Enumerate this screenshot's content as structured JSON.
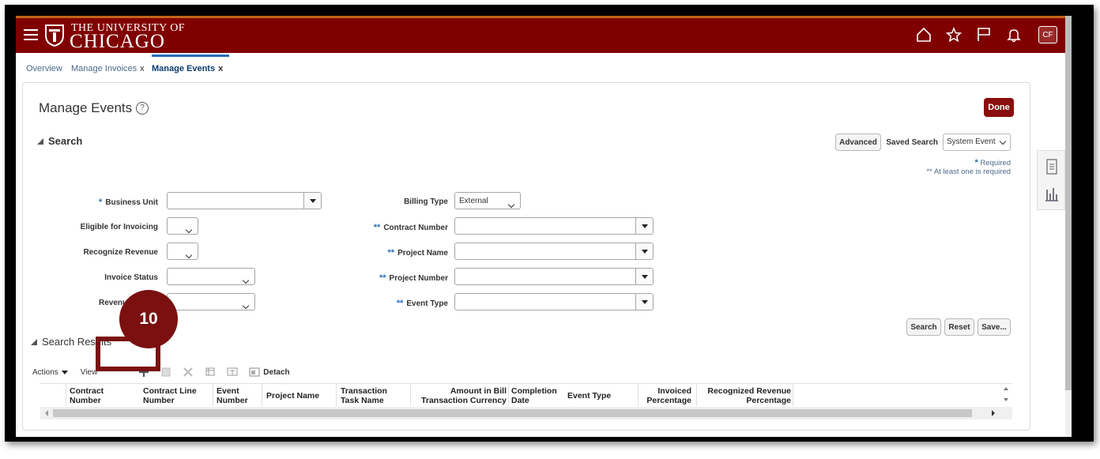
{
  "brand": {
    "line1": "THE UNIVERSITY OF",
    "line2": "CHICAGO"
  },
  "topbar": {
    "icons": [
      "home-icon",
      "star-icon",
      "flag-icon",
      "bell-icon"
    ],
    "user_initials": "CF",
    "color": "#800000"
  },
  "tabs": [
    {
      "label": "Overview",
      "closable": false,
      "active": false
    },
    {
      "label": "Manage Invoices",
      "closable": true,
      "active": false
    },
    {
      "label": "Manage Events",
      "closable": true,
      "active": true
    }
  ],
  "tab_close_glyph": "x",
  "page": {
    "title": "Manage Events",
    "help_glyph": "?",
    "done_label": "Done"
  },
  "search": {
    "header": "Search",
    "advanced_label": "Advanced",
    "saved_search_label": "Saved Search",
    "saved_search_value": "System Event",
    "required_note": "Required",
    "required_marker": "*",
    "atleast_note": "** At least one is required",
    "left_fields": [
      {
        "label": "Business Unit",
        "marker": "*",
        "value": ""
      },
      {
        "label": "Eligible for Invoicing",
        "marker": "",
        "value": ""
      },
      {
        "label": "Recognize Revenue",
        "marker": "",
        "value": ""
      },
      {
        "label": "Invoice Status",
        "marker": "",
        "value": ""
      },
      {
        "label": "Revenue Status",
        "marker": "",
        "value": ""
      }
    ],
    "right_fields": [
      {
        "label": "Billing Type",
        "marker": "",
        "value": "External"
      },
      {
        "label": "Contract Number",
        "marker": "**",
        "value": ""
      },
      {
        "label": "Project Name",
        "marker": "**",
        "value": ""
      },
      {
        "label": "Project Number",
        "marker": "**",
        "value": ""
      },
      {
        "label": "Event Type",
        "marker": "**",
        "value": ""
      }
    ],
    "buttons": {
      "search": "Search",
      "reset": "Reset",
      "save": "Save..."
    }
  },
  "results": {
    "header": "Search Results",
    "toolbar": {
      "actions": "Actions",
      "view": "View",
      "detach": "Detach"
    },
    "columns": [
      "Contract Number",
      "Contract Line Number",
      "Event Number",
      "Project Name",
      "Transaction Task Name",
      "Amount in Bill Transaction Currency",
      "Completion Date",
      "Event Type",
      "Invoiced Percentage",
      "Recognized Revenue Percentage"
    ]
  },
  "callout": {
    "number": "10",
    "color": "#7a1010"
  }
}
